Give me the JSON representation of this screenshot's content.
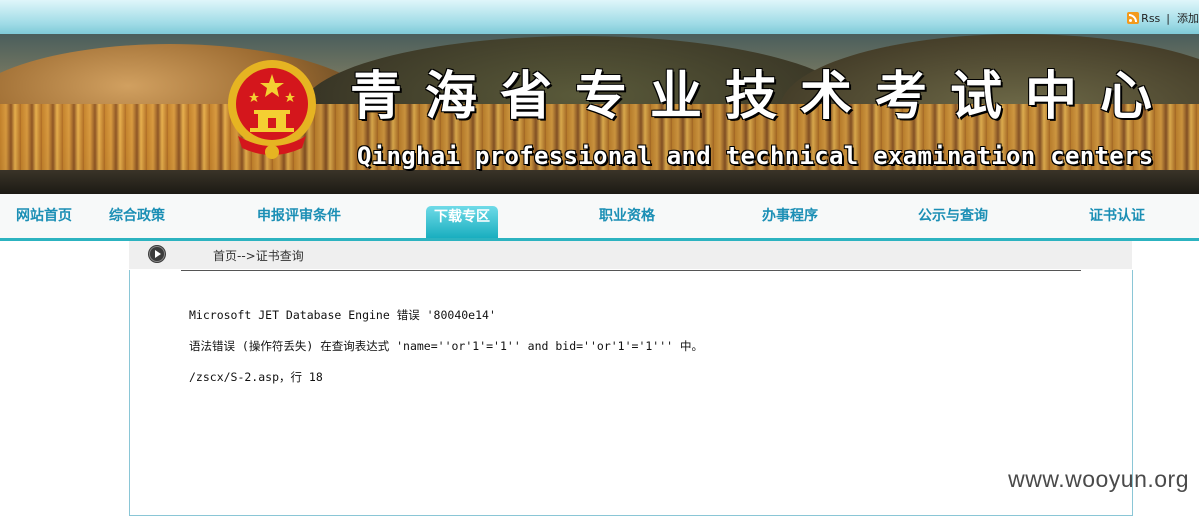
{
  "topbar": {
    "rss_label": "Rss",
    "separator": "|",
    "add_label": "添加"
  },
  "header": {
    "title_cn": "青海省专业技术考试中心",
    "title_en": "Qinghai professional and technical examination centers",
    "emblem_icon": "national-emblem-icon"
  },
  "nav": {
    "items": [
      {
        "label": "网站首页"
      },
      {
        "label": "综合政策"
      },
      {
        "label": "申报评审条件"
      },
      {
        "label": "下载专区",
        "active": true
      },
      {
        "label": "职业资格"
      },
      {
        "label": "办事程序"
      },
      {
        "label": "公示与查询"
      },
      {
        "label": "证书认证"
      }
    ]
  },
  "breadcrumb": {
    "icon": "play-circle-icon",
    "text": "首页-->证书查询"
  },
  "error": {
    "line1": "Microsoft JET Database Engine 错误 '80040e14'",
    "line2": "语法错误 (操作符丢失) 在查询表达式 'name=''or'1'='1'' and bid=''or'1'='1''' 中。",
    "line3": "/zscx/S-2.asp，行 18"
  },
  "watermark": "www.wooyun.org",
  "colors": {
    "accent": "#2cb3c0",
    "nav_text": "#1b8fb5",
    "active_tab": "#19aebf"
  }
}
